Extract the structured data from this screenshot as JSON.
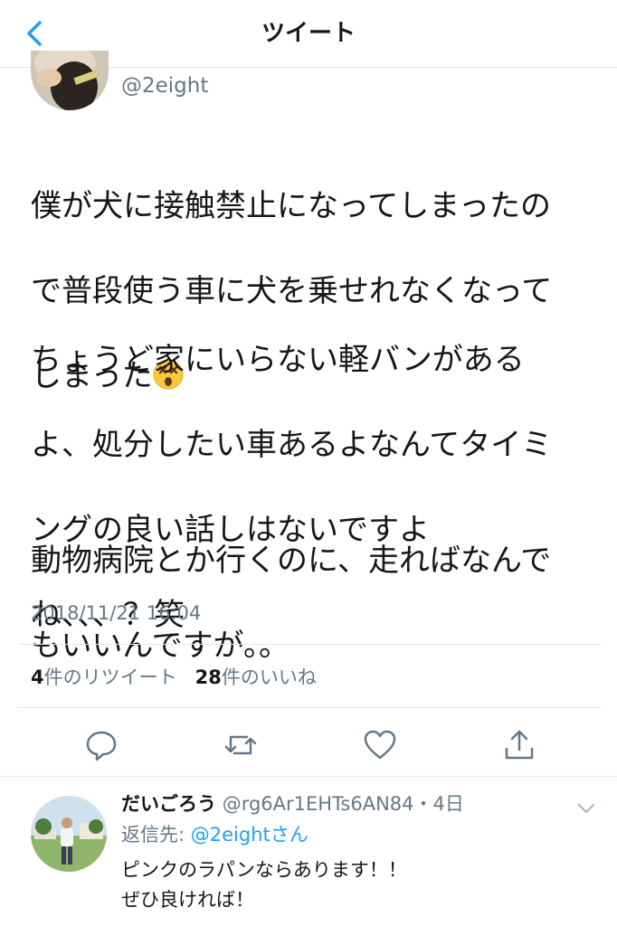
{
  "header": {
    "title": "ツイート",
    "back_icon": "chevron-left-icon",
    "accent": "#1da1f2"
  },
  "tweet": {
    "handle": "@2eight",
    "paragraphs": [
      "僕が犬に接触禁止になってしまったので普段使う車に犬を乗せれなくなってしまった",
      "ちょうど家にいらない軽バンがあるよ、処分したい車あるよなんてタイミングの良い話しはないですよね、、、？笑",
      "動物病院とか行くのに、走ればなんでもいいんですが。。"
    ],
    "lines": [
      "僕が犬に接触禁止になってしまったの",
      "で普段使う車に犬を乗せれなくなって",
      "しまった",
      "ちょうど家にいらない軽バンがある",
      "よ、処分したい車あるよなんてタイミ",
      "ングの良い話しはないですよ",
      "ね、、、？笑",
      "動物病院とか行くのに、走ればなんで",
      "もいいんですが。。"
    ],
    "emoji": "dizzy-face-emoji",
    "timestamp": "2018/11/21 16:04",
    "retweet_count": "4",
    "retweet_label": "件のリツイート",
    "like_count": "28",
    "like_label": "件のいいね"
  },
  "actions": {
    "reply_icon": "reply-icon",
    "retweet_icon": "retweet-icon",
    "like_icon": "heart-icon",
    "share_icon": "share-icon"
  },
  "reply": {
    "display_name": "だいごろう",
    "handle": "@rg6Ar1EHTs6AN84",
    "separator": "・",
    "time": "4日",
    "reply_to_label": "返信先: ",
    "reply_to_mention": "@2eight",
    "reply_to_suffix": "さん",
    "text_line1": "ピンクのラパンならあります！！",
    "text_line2": "ぜひ良ければ！",
    "menu_icon": "chevron-down-icon"
  }
}
